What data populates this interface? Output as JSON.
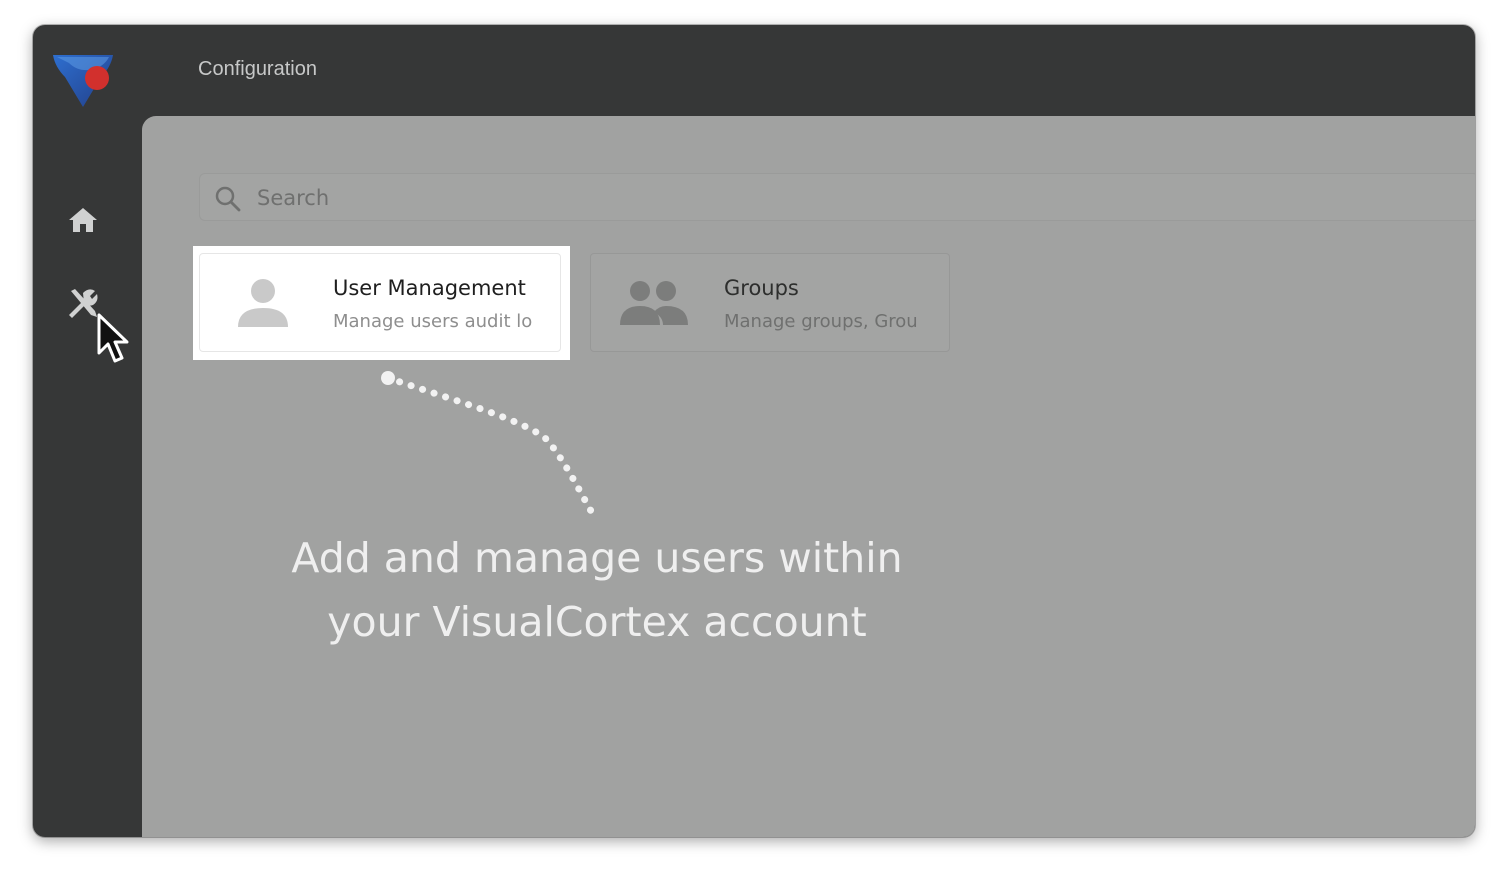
{
  "header": {
    "title": "Configuration"
  },
  "sidebar": {
    "items": [
      {
        "icon": "home-icon"
      },
      {
        "icon": "tools-icon"
      }
    ]
  },
  "search": {
    "placeholder": "Search"
  },
  "cards": [
    {
      "icon": "person-icon",
      "title": "User Management",
      "description": "Manage users audit lo",
      "highlighted": true
    },
    {
      "icon": "people-icon",
      "title": "Groups",
      "description": "Manage groups, Grou",
      "highlighted": false
    }
  ],
  "callout": {
    "line1": "Add and manage users within",
    "line2": "your VisualCortex account"
  },
  "colors": {
    "logo_blue": "#2f63b8",
    "logo_red": "#d2302d",
    "sidebar_bg": "#363737",
    "content_overlay": "#a1a2a1",
    "callout_text": "#efefef"
  }
}
